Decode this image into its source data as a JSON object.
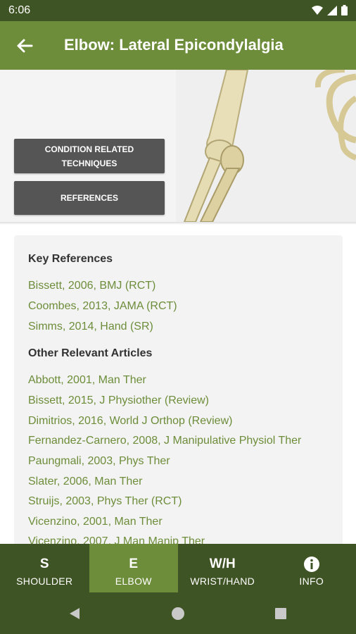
{
  "status": {
    "time": "6:06"
  },
  "header": {
    "title": "Elbow: Lateral Epicondylalgia"
  },
  "hero": {
    "buttons": [
      {
        "label": "CONDITION RELATED TECHNIQUES"
      },
      {
        "label": "REFERENCES"
      }
    ]
  },
  "references": {
    "key_heading": "Key References",
    "key": [
      "Bissett, 2006, BMJ (RCT)",
      "Coombes, 2013, JAMA (RCT)",
      "Simms, 2014, Hand (SR)"
    ],
    "other_heading": "Other Relevant Articles",
    "other": [
      "Abbott, 2001, Man Ther",
      "Bissett, 2015, J Physiother (Review)",
      "Dimitrios, 2016, World J Orthop (Review)",
      "Fernandez-Carnero, 2008, J Manipulative Physiol Ther",
      "Paungmali, 2003, Phys Ther",
      "Slater, 2006, Man Ther",
      "Struijs, 2003, Phys Ther (RCT)",
      "Vicenzino, 2001, Man Ther",
      "Vicenzino, 2007, J Man Manip Ther"
    ]
  },
  "nav": {
    "tabs": [
      {
        "glyph": "S",
        "label": "SHOULDER"
      },
      {
        "glyph": "E",
        "label": "ELBOW"
      },
      {
        "glyph": "W/H",
        "label": "WRIST/HAND"
      },
      {
        "glyph": "i",
        "label": "INFO"
      }
    ]
  },
  "colors": {
    "primary": "#6d8d3a",
    "primary_dark": "#3f5424",
    "button": "#555555"
  }
}
